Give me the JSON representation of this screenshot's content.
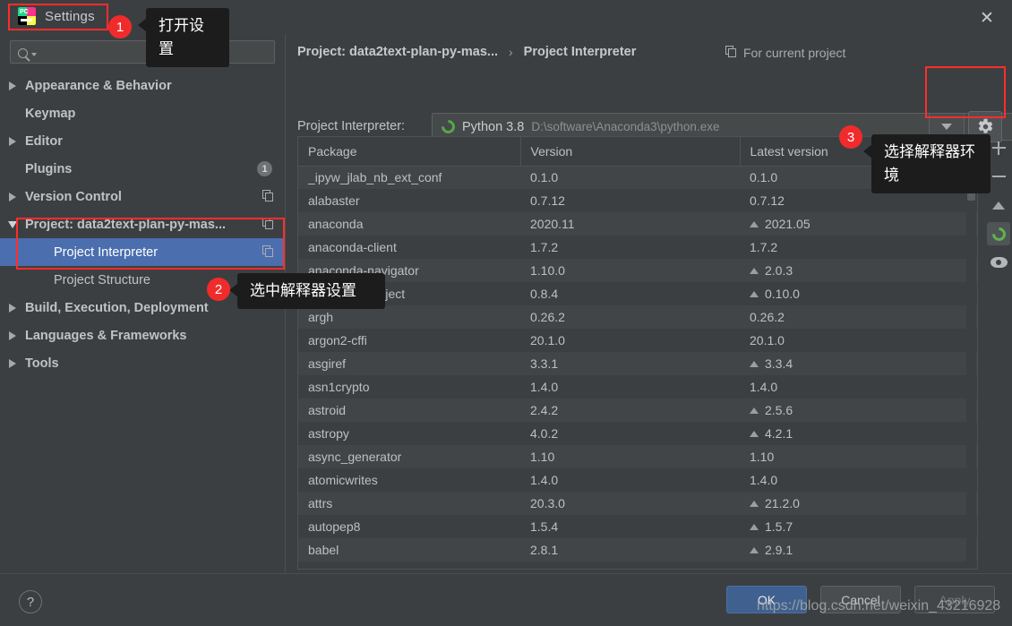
{
  "window": {
    "title": "Settings",
    "app_icon": "pycharm-icon",
    "close_icon": "close-icon"
  },
  "search": {
    "placeholder": "",
    "value": "",
    "icon": "search-icon"
  },
  "sidebar": {
    "items": [
      {
        "label": "Appearance & Behavior",
        "twisty": "right",
        "bold": true,
        "child": false,
        "selected": false,
        "badge": "",
        "copy": false
      },
      {
        "label": "Keymap",
        "twisty": "none",
        "bold": true,
        "child": false,
        "selected": false,
        "badge": "",
        "copy": false
      },
      {
        "label": "Editor",
        "twisty": "right",
        "bold": true,
        "child": false,
        "selected": false,
        "badge": "",
        "copy": false
      },
      {
        "label": "Plugins",
        "twisty": "none",
        "bold": true,
        "child": false,
        "selected": false,
        "badge": "1",
        "copy": false
      },
      {
        "label": "Version Control",
        "twisty": "right",
        "bold": true,
        "child": false,
        "selected": false,
        "badge": "",
        "copy": true
      },
      {
        "label": "Project: data2text-plan-py-mas...",
        "twisty": "down",
        "bold": true,
        "child": false,
        "selected": false,
        "badge": "",
        "copy": true
      },
      {
        "label": "Project Interpreter",
        "twisty": "none",
        "bold": false,
        "child": true,
        "selected": true,
        "badge": "",
        "copy": true
      },
      {
        "label": "Project Structure",
        "twisty": "none",
        "bold": false,
        "child": true,
        "selected": false,
        "badge": "",
        "copy": true
      },
      {
        "label": "Build, Execution, Deployment",
        "twisty": "right",
        "bold": true,
        "child": false,
        "selected": false,
        "badge": "",
        "copy": false
      },
      {
        "label": "Languages & Frameworks",
        "twisty": "right",
        "bold": true,
        "child": false,
        "selected": false,
        "badge": "",
        "copy": false
      },
      {
        "label": "Tools",
        "twisty": "right",
        "bold": true,
        "child": false,
        "selected": false,
        "badge": "",
        "copy": false
      }
    ]
  },
  "main": {
    "breadcrumb": {
      "parent": "Project: data2text-plan-py-mas...",
      "separator": "›",
      "current": "Project Interpreter"
    },
    "for_current_project": "For current project",
    "interpreter": {
      "label": "Project Interpreter:",
      "name": "Python 3.8",
      "path": "D:\\software\\Anaconda3\\python.exe",
      "dropdown_icon": "chevron-down-icon",
      "gear_icon": "gear-icon"
    },
    "table": {
      "columns": [
        "Package",
        "Version",
        "Latest version"
      ],
      "rows": [
        {
          "package": "_ipyw_jlab_nb_ext_conf",
          "version": "0.1.0",
          "latest": "0.1.0",
          "upgrade": false
        },
        {
          "package": "alabaster",
          "version": "0.7.12",
          "latest": "0.7.12",
          "upgrade": false
        },
        {
          "package": "anaconda",
          "version": "2020.11",
          "latest": "2021.05",
          "upgrade": true
        },
        {
          "package": "anaconda-client",
          "version": "1.7.2",
          "latest": "1.7.2",
          "upgrade": false
        },
        {
          "package": "anaconda-navigator",
          "version": "1.10.0",
          "latest": "2.0.3",
          "upgrade": true
        },
        {
          "package": "anaconda-project",
          "version": "0.8.4",
          "latest": "0.10.0",
          "upgrade": true
        },
        {
          "package": "argh",
          "version": "0.26.2",
          "latest": "0.26.2",
          "upgrade": false
        },
        {
          "package": "argon2-cffi",
          "version": "20.1.0",
          "latest": "20.1.0",
          "upgrade": false
        },
        {
          "package": "asgiref",
          "version": "3.3.1",
          "latest": "3.3.4",
          "upgrade": true
        },
        {
          "package": "asn1crypto",
          "version": "1.4.0",
          "latest": "1.4.0",
          "upgrade": false
        },
        {
          "package": "astroid",
          "version": "2.4.2",
          "latest": "2.5.6",
          "upgrade": true
        },
        {
          "package": "astropy",
          "version": "4.0.2",
          "latest": "4.2.1",
          "upgrade": true
        },
        {
          "package": "async_generator",
          "version": "1.10",
          "latest": "1.10",
          "upgrade": false
        },
        {
          "package": "atomicwrites",
          "version": "1.4.0",
          "latest": "1.4.0",
          "upgrade": false
        },
        {
          "package": "attrs",
          "version": "20.3.0",
          "latest": "21.2.0",
          "upgrade": true
        },
        {
          "package": "autopep8",
          "version": "1.5.4",
          "latest": "1.5.7",
          "upgrade": true
        },
        {
          "package": "babel",
          "version": "2.8.1",
          "latest": "2.9.1",
          "upgrade": true
        }
      ]
    },
    "package_toolbar": [
      {
        "icon": "plus-icon",
        "active": false
      },
      {
        "icon": "minus-icon",
        "active": false
      },
      {
        "icon": "up-arrow-icon",
        "active": false
      },
      {
        "icon": "refresh-icon",
        "active": true
      },
      {
        "icon": "eye-icon",
        "active": false
      }
    ]
  },
  "footer": {
    "help_label": "?",
    "ok_label": "OK",
    "cancel_label": "Cancel",
    "apply_label": "Apply",
    "watermark": "https://blog.csdn.net/weixin_43216928"
  },
  "annotations": [
    {
      "step": "1",
      "text": "打开设置"
    },
    {
      "step": "2",
      "text": "选中解释器设置"
    },
    {
      "step": "3",
      "text": "选择解释器环境"
    }
  ],
  "colors": {
    "background": "#3c3f41",
    "selection": "#4b6eaf",
    "accent_red": "#f12b2b",
    "ok_button": "#40618f",
    "python_green": "#57a64a"
  }
}
